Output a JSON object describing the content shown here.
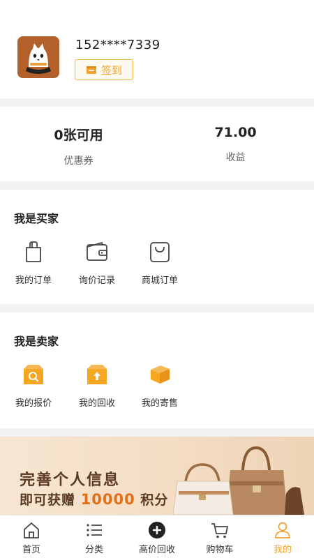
{
  "profile": {
    "phone": "152****7339",
    "signin_label": "签到"
  },
  "stats": [
    {
      "value": "0张可用",
      "label": "优惠券"
    },
    {
      "value": "71.00",
      "label": "收益"
    }
  ],
  "buyer": {
    "title": "我是买家",
    "items": [
      {
        "label": "我的订单"
      },
      {
        "label": "询价记录"
      },
      {
        "label": "商城订单"
      }
    ]
  },
  "seller": {
    "title": "我是卖家",
    "items": [
      {
        "label": "我的报价"
      },
      {
        "label": "我的回收"
      },
      {
        "label": "我的寄售"
      }
    ]
  },
  "banner": {
    "line1": "完善个人信息",
    "line2_prefix": "即可获赠",
    "line2_highlight": "10000",
    "line2_suffix": "积分"
  },
  "tabbar": {
    "tabs": [
      {
        "label": "首页"
      },
      {
        "label": "分类"
      },
      {
        "label": "高价回收"
      },
      {
        "label": "购物车"
      },
      {
        "label": "我的"
      }
    ],
    "active_index": 4
  },
  "colors": {
    "accent": "#f0a430",
    "seller_icon": "#f5a623",
    "banner_text": "#5a3a22",
    "banner_highlight": "#e0701a"
  },
  "icons": {
    "buyer": [
      "order-bag-icon",
      "wallet-icon",
      "shopping-bag-icon"
    ],
    "seller": [
      "quote-box-icon",
      "recycle-box-icon",
      "consign-box-icon"
    ],
    "tabs": [
      "home-icon",
      "category-list-icon",
      "plus-circle-icon",
      "cart-icon",
      "user-icon"
    ]
  }
}
